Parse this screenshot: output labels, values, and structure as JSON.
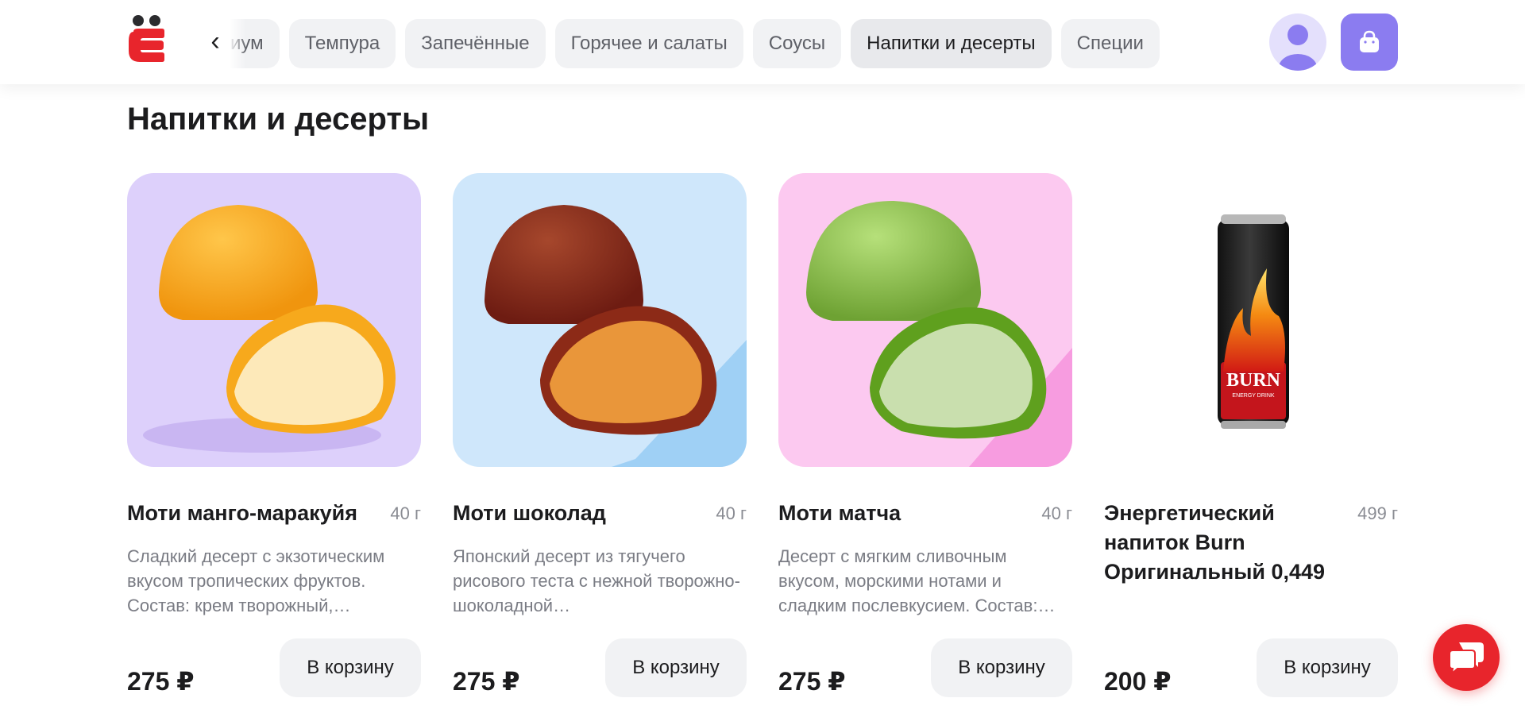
{
  "brand": {
    "accent": "#e8252c",
    "cart_color": "#8b7cf0"
  },
  "header": {
    "back_icon": "chevron-left-icon",
    "tabs": [
      {
        "label": "иум"
      },
      {
        "label": "Темпура"
      },
      {
        "label": "Запечённые"
      },
      {
        "label": "Горячее и салаты"
      },
      {
        "label": "Соусы"
      },
      {
        "label": "Напитки и десерты",
        "active": true
      },
      {
        "label": "Специи"
      }
    ],
    "profile_icon": "user-icon",
    "cart_icon": "shopping-bag-icon"
  },
  "section": {
    "title": "Напитки и десерты"
  },
  "products": [
    {
      "name": "Моти манго-маракуйя",
      "weight": "40 г",
      "description": "Сладкий десерт с экзотическим вкусом тропических фруктов. Состав: крем творожный,…",
      "price": "275 ₽",
      "button": "В корзину",
      "bg": "#ddd0fb"
    },
    {
      "name": "Моти шоколад",
      "weight": "40 г",
      "description": "Японский десерт из тягучего рисового теста с нежной творожно-шоколадной…",
      "price": "275 ₽",
      "button": "В корзину",
      "bg": "#cfe7fb"
    },
    {
      "name": "Моти матча",
      "weight": "40 г",
      "description": "Десерт с мягким сливочным вкусом, морскими нотами и сладким послевкусием. Состав:…",
      "price": "275 ₽",
      "button": "В корзину",
      "bg": "#fcc9f0"
    },
    {
      "name": "Энергетический напиток Burn Оригинальный 0,449",
      "weight": "499 г",
      "description": "",
      "price": "200 ₽",
      "button": "В корзину",
      "bg": "#ffffff",
      "can_text": "BURN",
      "can_subtext": "ENERGY DRINK"
    }
  ],
  "chat": {
    "icon": "chat-bubbles-icon"
  }
}
